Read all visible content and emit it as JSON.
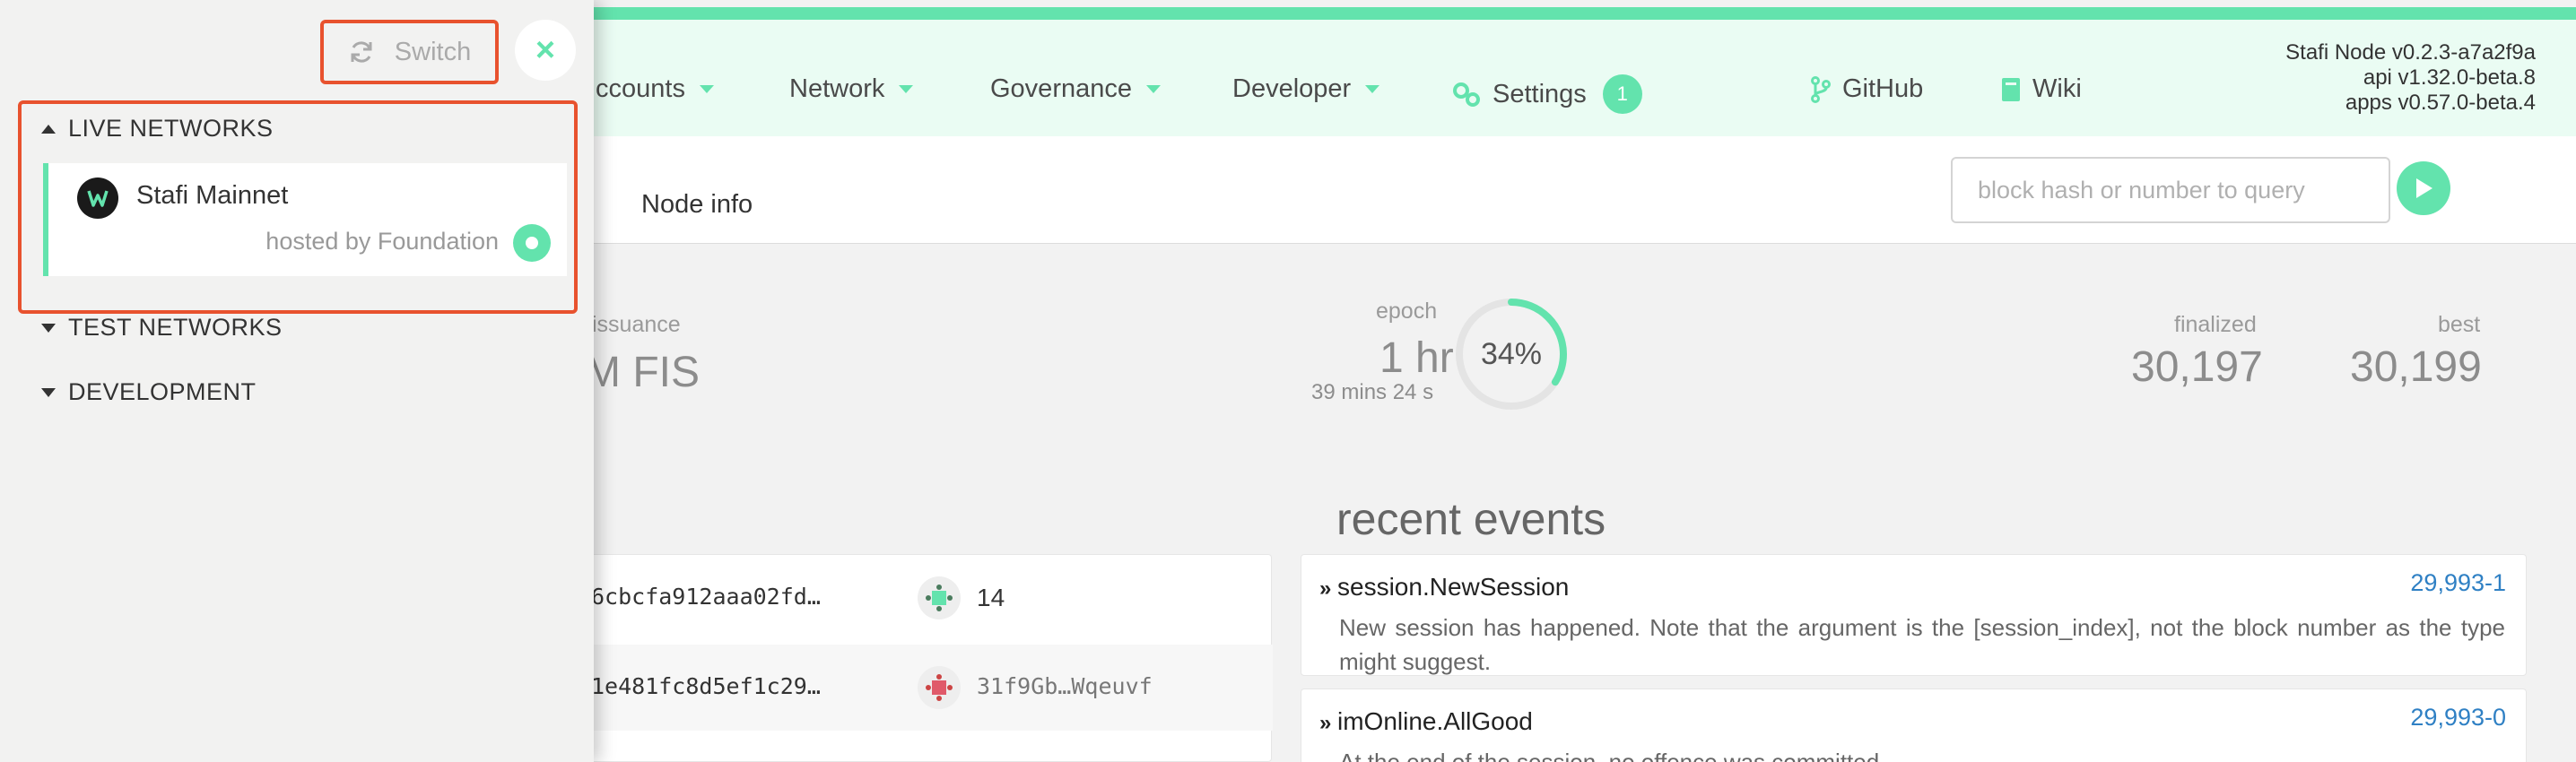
{
  "nav": {
    "accounts": "ccounts",
    "network": "Network",
    "governance": "Governance",
    "developer": "Developer",
    "settings": "Settings",
    "settings_badge": "1",
    "github": "GitHub",
    "wiki": "Wiki"
  },
  "version": {
    "node": "Stafi Node v0.2.3-a7a2f9a",
    "api": "api v1.32.0-beta.8",
    "apps": "apps v0.57.0-beta.4"
  },
  "subtabs": {
    "node_info": "Node info"
  },
  "search": {
    "placeholder": "block hash or number to query"
  },
  "stats": {
    "issuance_label": "issuance",
    "issuance_value": "M FIS",
    "epoch_label": "epoch",
    "epoch_value": "1 hr",
    "epoch_sub": "39 mins 24 s",
    "epoch_percent": "34%",
    "epoch_progress": 0.34,
    "finalized_label": "finalized",
    "finalized_value": "30,197",
    "best_label": "best",
    "best_value": "30,199"
  },
  "recent_events_title": "recent events",
  "blocks": [
    {
      "hash": "6cbcfa912aaa02fd…",
      "author": "14"
    },
    {
      "hash": "1e481fc8d5ef1c29…",
      "author": "31f9Gb…Wqeuvf"
    }
  ],
  "events": [
    {
      "name": "session.NewSession",
      "id": "29,993-1",
      "desc": "New session has happened. Note that the argument is the [session_index], not the block number as the type might suggest."
    },
    {
      "name": "imOnline.AllGood",
      "id": "29,993-0",
      "desc": "At the end of the session, no offence was committed."
    }
  ],
  "sidebar": {
    "switch_label": "Switch",
    "close_label": "×",
    "live_networks": "LIVE NETWORKS",
    "test_networks": "TEST NETWORKS",
    "development": "DEVELOPMENT",
    "network_name": "Stafi Mainnet",
    "network_host": "hosted by Foundation"
  },
  "colors": {
    "accent": "#63e3ad",
    "highlight": "#e8522e",
    "link": "#2f80c4"
  },
  "icons": [
    "refresh-icon",
    "close-icon",
    "gears-icon",
    "git-branch-icon",
    "book-icon",
    "play-icon",
    "chevron-double-right-icon",
    "stafi-logo-icon"
  ]
}
